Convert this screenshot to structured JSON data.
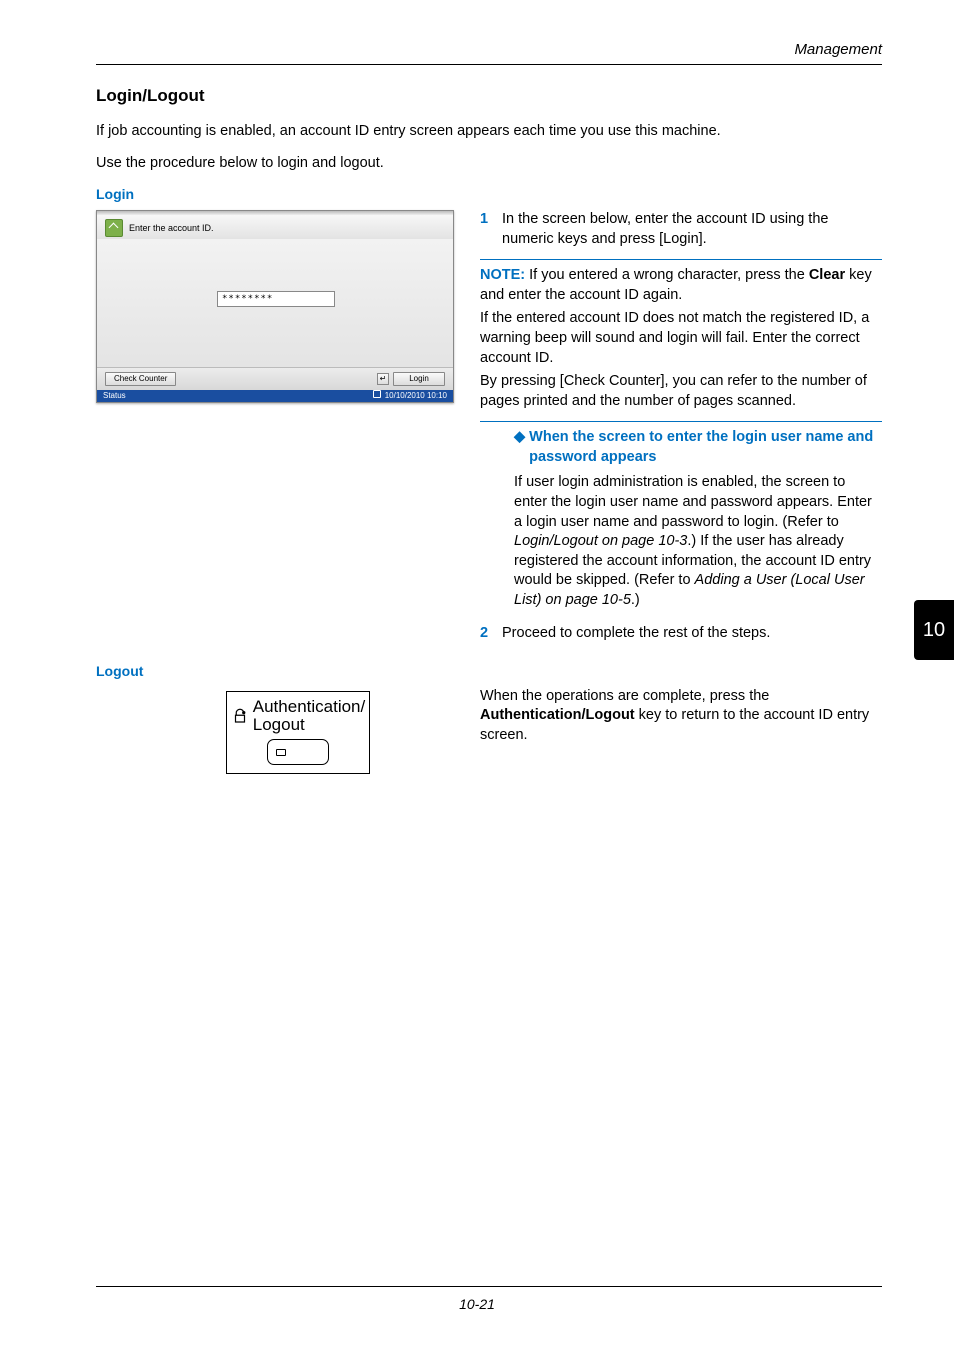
{
  "header": {
    "section": "Management"
  },
  "title": "Login/Logout",
  "intro": [
    "If job accounting is enabled, an account ID entry screen appears each time you use this machine.",
    "Use the procedure below to login and logout."
  ],
  "login": {
    "heading": "Login",
    "screen": {
      "prompt": "Enter the account ID.",
      "input_value": "********",
      "check_counter": "Check Counter",
      "enter_glyph": "↵",
      "login_btn": "Login",
      "status": "Status",
      "datetime": "10/10/2010 10:10"
    },
    "step1": "In the screen below, enter the account ID using the numeric keys and press [Login].",
    "note": {
      "label": "NOTE:",
      "line1": " If you entered a wrong character, press the ",
      "clear": "Clear",
      "line1b": " key and enter the account ID again.",
      "para2": "If the entered account ID does not match the registered ID, a warning beep will sound and login will fail. Enter the correct account ID.",
      "para3": "By pressing [Check Counter], you can refer to the number of pages printed and the number of pages scanned."
    },
    "sub": {
      "diamond": "◆",
      "title": "When the screen to enter the login user name and password appears",
      "para_a": "If user login administration is enabled, the screen to enter the login user name and password appears. Enter a login user name and password to login. (Refer to ",
      "ref1": "Login/Logout on page 10-3",
      "para_b": ".) If the user has already registered the account information, the account ID entry would be skipped. (Refer to ",
      "ref2": "Adding a User (Local User List) on page 10-5",
      "para_c": ".)"
    },
    "step2": "Proceed to complete the rest of the steps."
  },
  "logout": {
    "heading": "Logout",
    "key_label": "Authentication/\nLogout",
    "para_a": "When the operations are complete, press the ",
    "bold": "Authentication/Logout",
    "para_b": " key to return to the account ID entry screen."
  },
  "side_tab": "10",
  "footer": "10-21"
}
